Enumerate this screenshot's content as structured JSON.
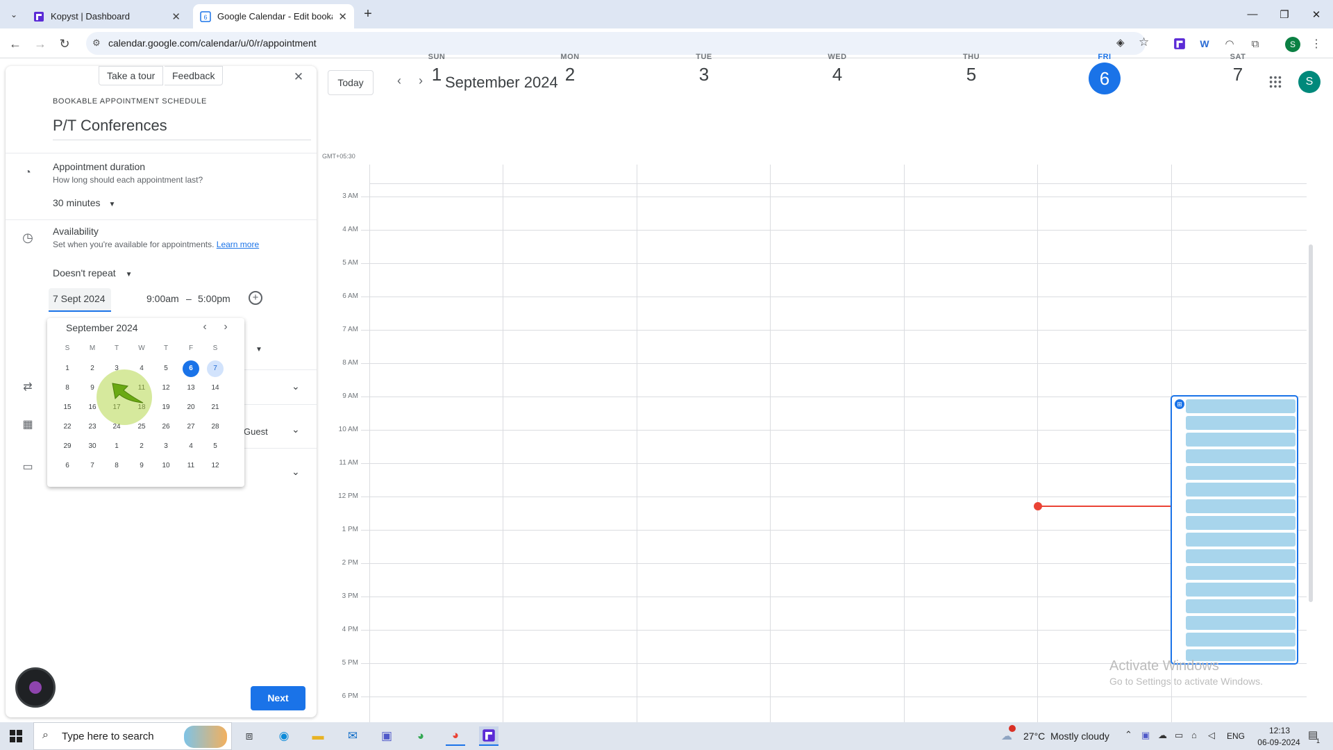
{
  "browser": {
    "tabs": [
      {
        "title": "Kopyst | Dashboard"
      },
      {
        "title": "Google Calendar - Edit bookab"
      }
    ],
    "url": "calendar.google.com/calendar/u/0/r/appointment",
    "profile_initial": "S"
  },
  "panel": {
    "take_tour": "Take a tour",
    "feedback": "Feedback",
    "heading": "BOOKABLE APPOINTMENT SCHEDULE",
    "title": "P/T Conferences",
    "duration_label": "Appointment duration",
    "duration_sub": "How long should each appointment last?",
    "duration_value": "30 minutes",
    "availability_label": "Availability",
    "availability_sub": "Set when you're available for appointments.",
    "learn_more": "Learn more",
    "repeat_value": "Doesn't repeat",
    "date_value": "7 Sept 2024",
    "start_time": "9:00am",
    "dash": "–",
    "end_time": "5:00pm",
    "guest_text": "Guest",
    "next_button": "Next"
  },
  "picker": {
    "month": "September 2024",
    "weekdays": [
      "S",
      "M",
      "T",
      "W",
      "T",
      "F",
      "S"
    ],
    "weeks": [
      [
        "1",
        "2",
        "3",
        "4",
        "5",
        "6",
        "7"
      ],
      [
        "8",
        "9",
        "10",
        "11",
        "12",
        "13",
        "14"
      ],
      [
        "15",
        "16",
        "17",
        "18",
        "19",
        "20",
        "21"
      ],
      [
        "22",
        "23",
        "24",
        "25",
        "26",
        "27",
        "28"
      ],
      [
        "29",
        "30",
        "1",
        "2",
        "3",
        "4",
        "5"
      ],
      [
        "6",
        "7",
        "8",
        "9",
        "10",
        "11",
        "12"
      ]
    ],
    "today": "6",
    "selected": "7"
  },
  "calendar": {
    "today_button": "Today",
    "month_title": "September 2024",
    "timezone": "GMT+05:30",
    "days": [
      {
        "dow": "SUN",
        "num": "1"
      },
      {
        "dow": "MON",
        "num": "2"
      },
      {
        "dow": "TUE",
        "num": "3"
      },
      {
        "dow": "WED",
        "num": "4"
      },
      {
        "dow": "THU",
        "num": "5"
      },
      {
        "dow": "FRI",
        "num": "6"
      },
      {
        "dow": "SAT",
        "num": "7"
      }
    ],
    "hours": [
      "3 AM",
      "4 AM",
      "5 AM",
      "6 AM",
      "7 AM",
      "8 AM",
      "9 AM",
      "10 AM",
      "11 AM",
      "12 PM",
      "1 PM",
      "2 PM",
      "3 PM",
      "4 PM",
      "5 PM",
      "6 PM"
    ],
    "avatar_initial": "S",
    "watermark_title": "Activate Windows",
    "watermark_sub": "Go to Settings to activate Windows."
  },
  "taskbar": {
    "search_placeholder": "Type here to search",
    "weather": "27°C  Mostly cloudy",
    "lang": "ENG",
    "time": "12:13",
    "date": "06-09-2024",
    "notif_count": "1"
  },
  "colors": {
    "accent": "#1a73e8",
    "slot_fill": "#a8d5ec",
    "now_line": "#ea4335"
  }
}
